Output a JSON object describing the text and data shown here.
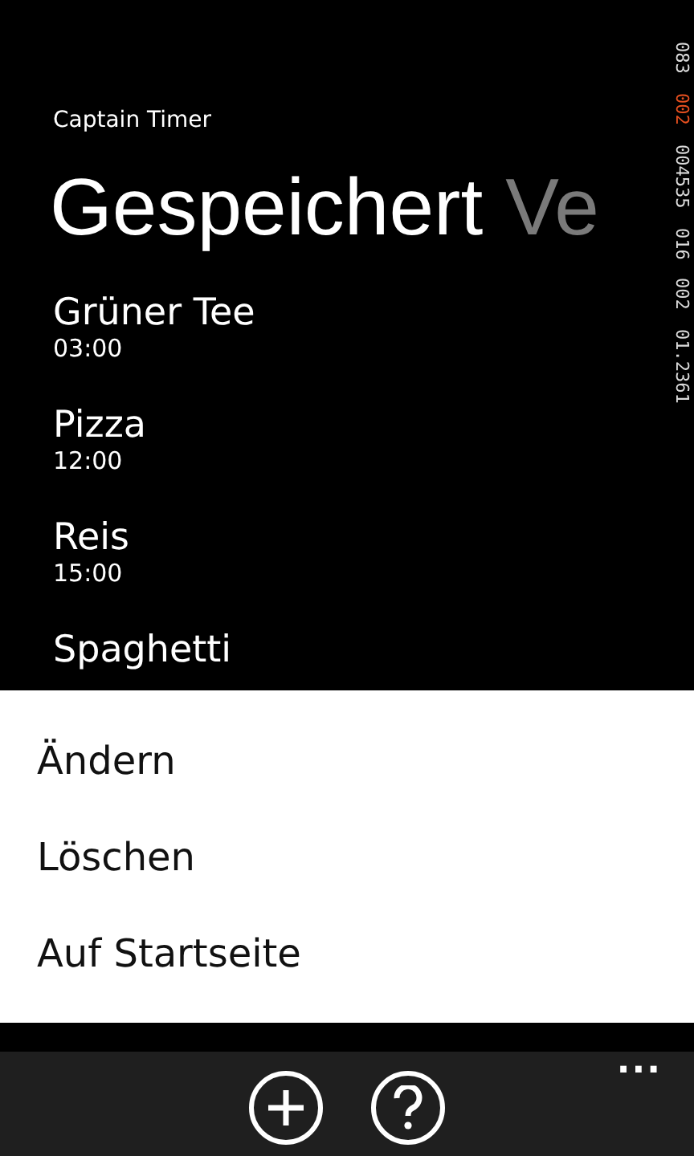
{
  "app_title": "Captain Timer",
  "pivot": [
    {
      "label": "Gespeichert",
      "selected": true
    },
    {
      "label": "Ve",
      "selected": false
    }
  ],
  "timers": [
    {
      "name": "Grüner Tee",
      "time": "03:00"
    },
    {
      "name": "Pizza",
      "time": "12:00"
    },
    {
      "name": "Reis",
      "time": "15:00"
    },
    {
      "name": "Spaghetti"
    }
  ],
  "debug_counter": [
    {
      "text": "083",
      "highlight": false
    },
    {
      "text": "002",
      "highlight": true
    },
    {
      "text": "004535",
      "highlight": false
    },
    {
      "text": "016",
      "highlight": false
    },
    {
      "text": "002",
      "highlight": false
    },
    {
      "text": "01.2361",
      "highlight": false
    }
  ],
  "context_menu": [
    "Ändern",
    "Löschen",
    "Auf Startseite"
  ],
  "app_bar": {
    "buttons": [
      {
        "kind": "add"
      },
      {
        "kind": "help"
      }
    ],
    "more": "..."
  }
}
